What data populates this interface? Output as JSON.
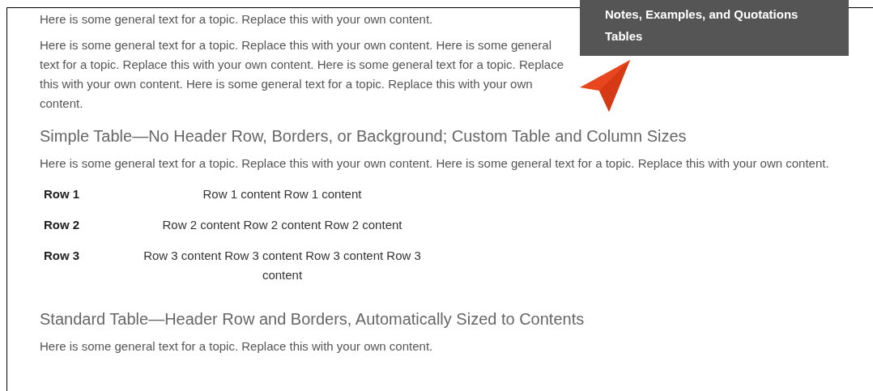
{
  "menu": {
    "items": [
      {
        "label": "Notes, Examples, and Quotations"
      },
      {
        "label": "Tables"
      }
    ]
  },
  "content": [
    {
      "kind": "paragraph",
      "text": "Here is some general text for a topic. Replace this with your own content."
    },
    {
      "kind": "paragraph",
      "text": "Here is some general text for a topic. Replace this with your own content. Here is some general text for a topic. Replace this with your own content. Here is some general text for a topic. Replace this with your own content. Here is some general text for a topic. Replace this with your own content."
    },
    {
      "kind": "heading",
      "text": "Simple Table—No Header Row, Borders, or Background; Custom Table and Column Sizes"
    },
    {
      "kind": "paragraph",
      "text": "Here is some general text for a topic. Replace this with your own content. Here is some general text for a topic. Replace this with your own content."
    },
    {
      "kind": "table",
      "rows": [
        {
          "label": "Row 1",
          "content": "Row 1 content Row 1 content"
        },
        {
          "label": "Row 2",
          "content": "Row 2 content Row 2 content Row 2 content"
        },
        {
          "label": "Row 3",
          "content": "Row 3 content Row 3 content Row 3 content Row 3 content"
        }
      ]
    },
    {
      "kind": "heading",
      "text": "Standard Table—Header Row and Borders, Automatically Sized to Contents"
    },
    {
      "kind": "paragraph",
      "text": "Here is some general text for a topic. Replace this with your own content."
    }
  ]
}
